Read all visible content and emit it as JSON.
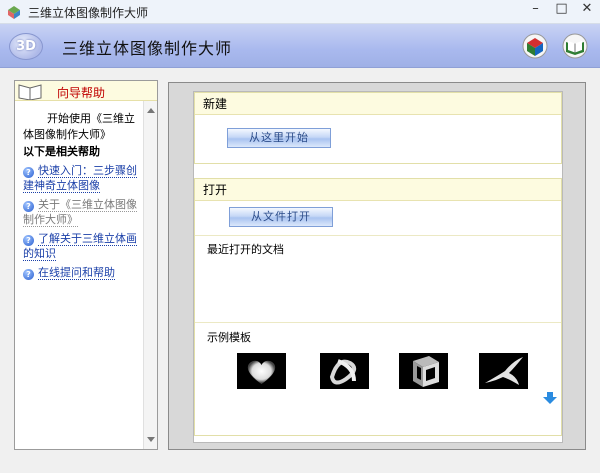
{
  "window": {
    "title": "三维立体图像制作大师"
  },
  "header": {
    "logo_text": "3D",
    "title": "三维立体图像制作大师"
  },
  "sidebar": {
    "title": "向导帮助",
    "intro": "开始使用《三维立体图像制作大师》",
    "related_heading": "以下是相关帮助",
    "links": [
      {
        "label": "快速入门：三步骤创建神奇立体图像",
        "visited": false
      },
      {
        "label": "关于《三维立体图像制作大师》",
        "visited": true
      },
      {
        "label": "了解关于三维立体画的知识",
        "visited": false
      },
      {
        "label": "在线提问和帮助",
        "visited": false
      }
    ]
  },
  "new_section": {
    "title": "新建",
    "button": "从这里开始"
  },
  "open_section": {
    "title": "打开",
    "button": "从文件打开",
    "recent_label": "最近打开的文档",
    "samples_label": "示例模板"
  },
  "icons": [
    "app-icon",
    "minimize-icon",
    "maximize-icon",
    "close-icon",
    "registration-icon",
    "help-book-icon",
    "book-icon",
    "help-question-icon",
    "scroll-down-arrow-icon"
  ],
  "colors": {
    "header_band": "#a9b9ee",
    "section_header": "#fdfbe0",
    "link": "#1a3fa8",
    "sidebar_title": "#c00000"
  }
}
